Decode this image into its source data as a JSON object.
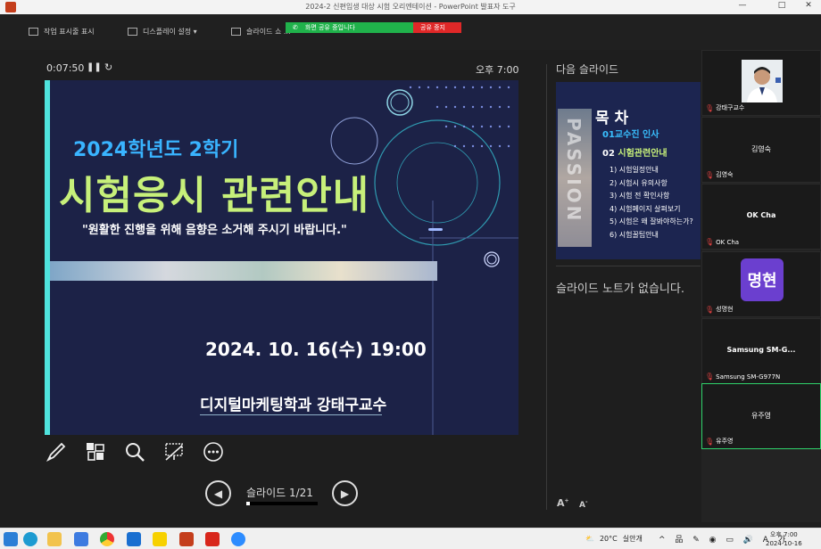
{
  "window": {
    "title": "2024-2 신편입생 대상 시험 오리엔테이션 - PowerPoint 발표자 도구",
    "minimize": "—",
    "maximize": "□",
    "close": "✕"
  },
  "toolbar": {
    "taskbar_label": "작업 표시줄 표시",
    "display_settings_label": "디스플레이 설정 ▾",
    "slideshow_label": "슬라이드 쇼 ..."
  },
  "share_banner": {
    "status": "화면 공유 중입니다",
    "stop": "공유 중지"
  },
  "presenter": {
    "timer": "0:07:50",
    "pause_icon": "pause-icon",
    "reset_icon": "reset-icon",
    "clock": "오후 7:00"
  },
  "current_slide": {
    "semester": "2024학년도 2학기",
    "title": "시험응시 관련안내",
    "quote": "\"원활한 진행을 위해 음향은 소거해 주시기 바랍니다.\"",
    "date": "2024. 10. 16(수) 19:00",
    "author": "디지털마케팅학과 강태구교수"
  },
  "navigation": {
    "counter": "슬라이드 1/21",
    "progress": 0.0476
  },
  "next_slide": {
    "label": "다음 슬라이드",
    "watermark": "PASSION",
    "toc_title": "목 차",
    "item1_num": "01",
    "item1": "교수진 인사",
    "item2_num": "02",
    "item2": "시험관련안내",
    "subitems": [
      "1) 시험일정안내",
      "2) 시험시 유의사항",
      "3) 시험 전 확인사항",
      "4) 시험페이지 살펴보기",
      "5) 시험은 왜 잘봐야하는가?",
      "6) 시험꿀팁안내"
    ]
  },
  "notes": {
    "text": "슬라이드 노트가 없습니다."
  },
  "font_controls": {
    "increase": "A",
    "decrease": "A"
  },
  "participants": [
    {
      "name": "강태구교수",
      "center": "",
      "type": "photo"
    },
    {
      "name": "김영숙",
      "center": "김영숙",
      "type": "name"
    },
    {
      "name": "OK Cha",
      "center": "OK Cha",
      "type": "name"
    },
    {
      "name": "성명현",
      "center": "명현",
      "type": "avatar"
    },
    {
      "name": "Samsung SM-G977N",
      "center": "Samsung  SM-G...",
      "type": "name"
    },
    {
      "name": "유주영",
      "center": "유주영",
      "type": "name"
    }
  ],
  "taskbar": {
    "temperature": "20°C",
    "weather": "실안개",
    "time": "오후 7:00",
    "date": "2024-10-16",
    "tray": "^ 品 ✎ ◉ ▭ 🔊 A 가"
  },
  "colors": {
    "slide_bg": "#1c2247",
    "accent_cyan": "#4fe3dd",
    "title_green": "#c7f07a",
    "semester_blue": "#39b4ff",
    "share_green": "#20b24b",
    "share_red": "#e02828",
    "active_speaker": "#2fd36b"
  }
}
